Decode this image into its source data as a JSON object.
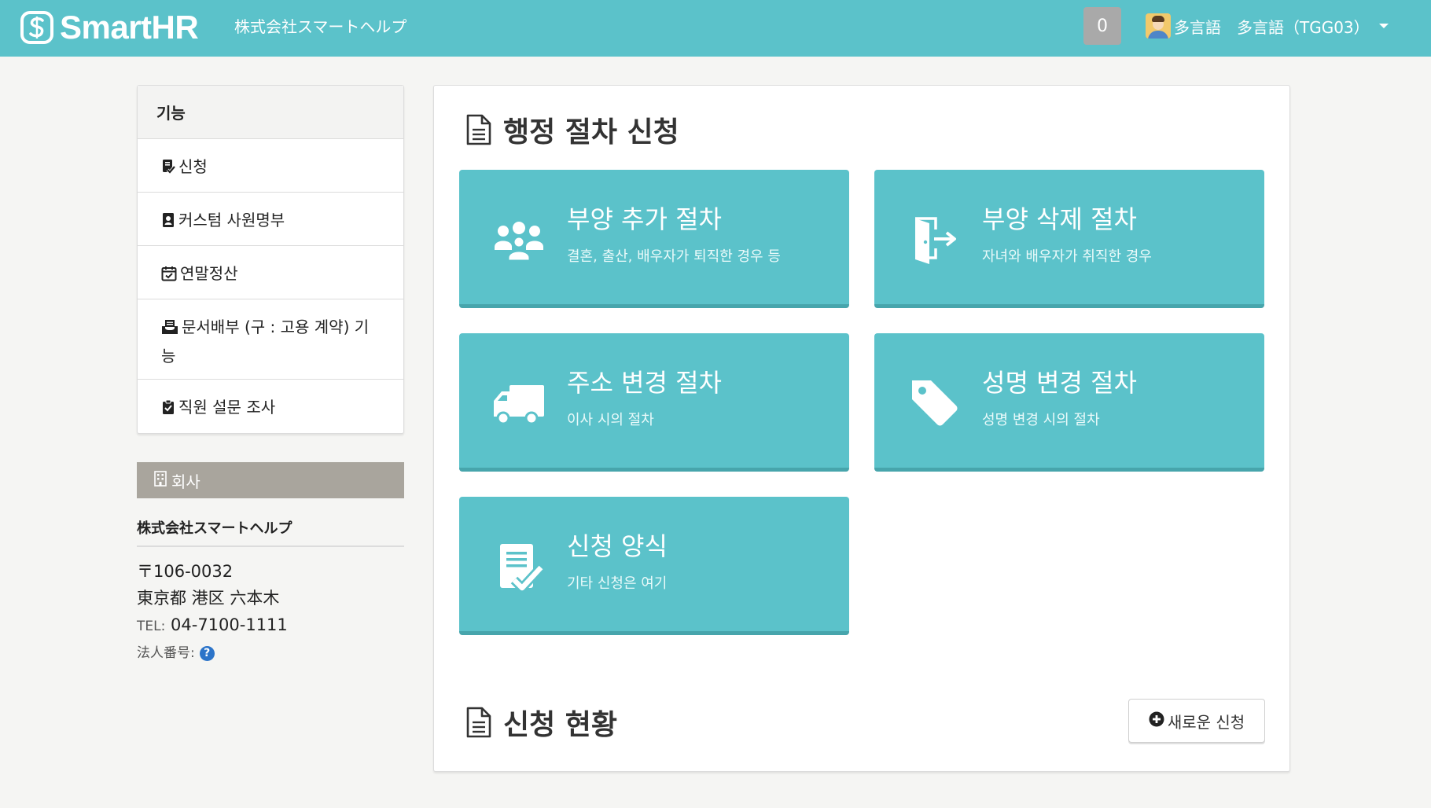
{
  "header": {
    "logo_text": "SmartHR",
    "company_name": "株式会社スマートヘルプ",
    "notification_count": "0",
    "user_label": "多言語　多言語（TGG03）",
    "colors": {
      "header_bg": "#5bc2ca",
      "badge_bg": "#a9a9a9"
    }
  },
  "sidebar": {
    "heading": "기능",
    "items": [
      {
        "label": "신청",
        "icon": "form-check-icon"
      },
      {
        "label": "커스텀 사원명부",
        "icon": "id-badge-icon"
      },
      {
        "label": "연말정산",
        "icon": "calendar-check-icon"
      },
      {
        "label": "문서배부 (구 : 고용 계약) 기능",
        "icon": "inbox-icon"
      },
      {
        "label": "직원 설문 조사",
        "icon": "clipboard-check-icon"
      }
    ]
  },
  "company": {
    "heading": "회사",
    "name": "株式会社スマートヘルプ",
    "postal": "〒106-0032",
    "address": "東京都 港区 六本木",
    "tel_label": "TEL:",
    "tel": "04-7100-1111",
    "corp_number_label": "法人番号:",
    "help_glyph": "?"
  },
  "main": {
    "section_title": "행정 절차 신청",
    "cards": [
      {
        "title": "부양 추가 절차",
        "desc": "결혼, 출산, 배우자가 퇴직한 경우 등",
        "icon": "users-icon"
      },
      {
        "title": "부양 삭제 절차",
        "desc": "자녀와 배우자가 취직한 경우",
        "icon": "door-exit-icon"
      },
      {
        "title": "주소 변경 절차",
        "desc": "이사 시의 절차",
        "icon": "truck-icon"
      },
      {
        "title": "성명 변경 절차",
        "desc": "성명 변경 시의 절차",
        "icon": "tag-icon"
      },
      {
        "title": "신청 양식",
        "desc": "기타 신청은 여기",
        "icon": "form-check-icon"
      }
    ],
    "status_title": "신청 현황",
    "new_button_label": "새로운 신청",
    "colors": {
      "card_bg": "#5bc2ca",
      "card_border": "#47a5ac"
    }
  }
}
